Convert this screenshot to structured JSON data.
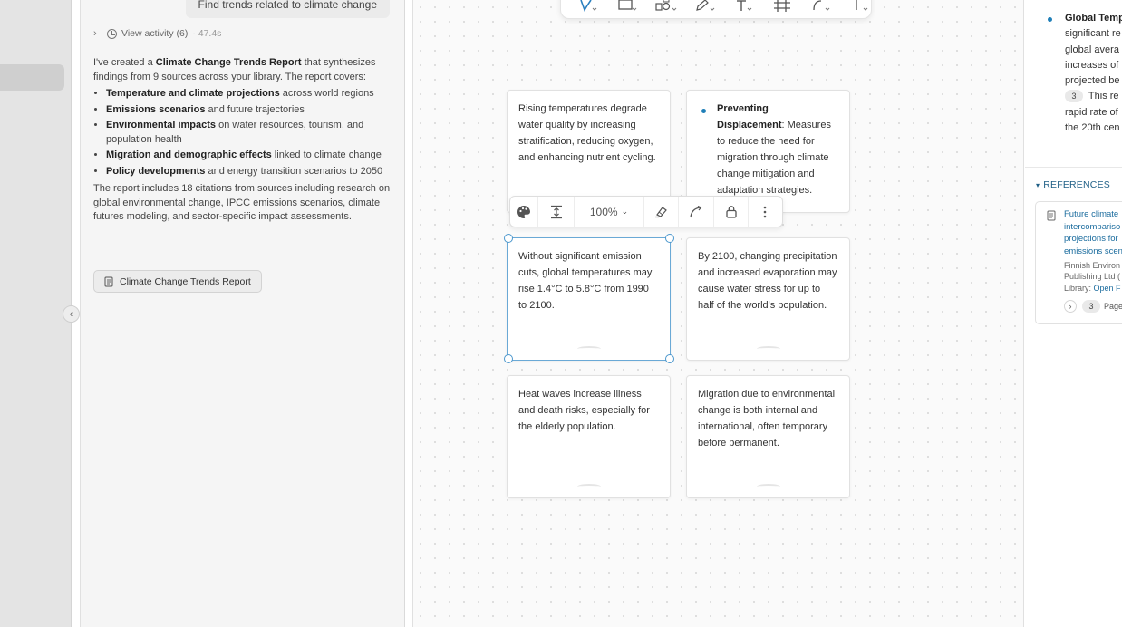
{
  "chat": {
    "user_message": "Find trends related to climate change",
    "activity": {
      "label": "View activity (6)",
      "duration": "· 47.4s"
    },
    "response": {
      "intro_prefix": "I've created a ",
      "intro_bold": "Climate Change Trends Report",
      "intro_suffix": " that synthesizes findings from 9 sources across your library. The report covers:",
      "bullets": [
        {
          "bold": "Temperature and climate projections",
          "text": " across world regions"
        },
        {
          "bold": "Emissions scenarios",
          "text": " and future trajectories"
        },
        {
          "bold": "Environmental impacts",
          "text": " on water resources, tourism, and population health"
        },
        {
          "bold": "Migration and demographic effects",
          "text": " linked to climate change"
        },
        {
          "bold": "Policy developments",
          "text": " and energy transition scenarios to 2050"
        }
      ],
      "closing": "The report includes 18 citations from sources including research on global environmental change, IPCC emissions scenarios, climate futures modeling, and sector-specific impact assessments."
    },
    "report_button": "Climate Change Trends Report"
  },
  "card_toolbar": {
    "zoom": "100%"
  },
  "cards": [
    {
      "text": "Rising temperatures degrade water quality by increasing stratification, reducing oxygen, and enhancing nutrient cycling."
    },
    {
      "bold": "Preventing Displacement",
      "text": ": Measures to reduce the need for migration through climate change mitigation and adaptation strategies."
    },
    {
      "text": "Without significant emission cuts, global temperatures may rise 1.4°C to 5.8°C from 1990 to 2100."
    },
    {
      "text": "By 2100, changing precipitation and increased evaporation may cause water stress for up to half of the world's population."
    },
    {
      "text": "Heat waves increase illness and death risks, especially for the elderly population."
    },
    {
      "text": "Migration due to environmental change is both internal and international, often temporary before permanent."
    }
  ],
  "right_panel": {
    "heading": "Global Temp",
    "lines": [
      "significant re",
      "global avera",
      "increases of",
      "projected be"
    ],
    "cite_number": "3",
    "line_after_cite": "This re",
    "lines_end": [
      "rapid rate of",
      "the 20th cen"
    ],
    "references_label": "REFERENCES",
    "reference": {
      "title_lines": [
        "Future climate",
        "intercompariso",
        "projections for",
        "emissions scen"
      ],
      "meta_lines": [
        "Finnish Environ",
        "Publishing Ltd ("
      ],
      "library_label": "Library: ",
      "library_link": "Open F",
      "cite_number": "3",
      "page_label": "Page"
    }
  },
  "colors": {
    "accent": "#1f7fb8",
    "selection": "#4b97cd",
    "link": "#1b6c9e"
  }
}
